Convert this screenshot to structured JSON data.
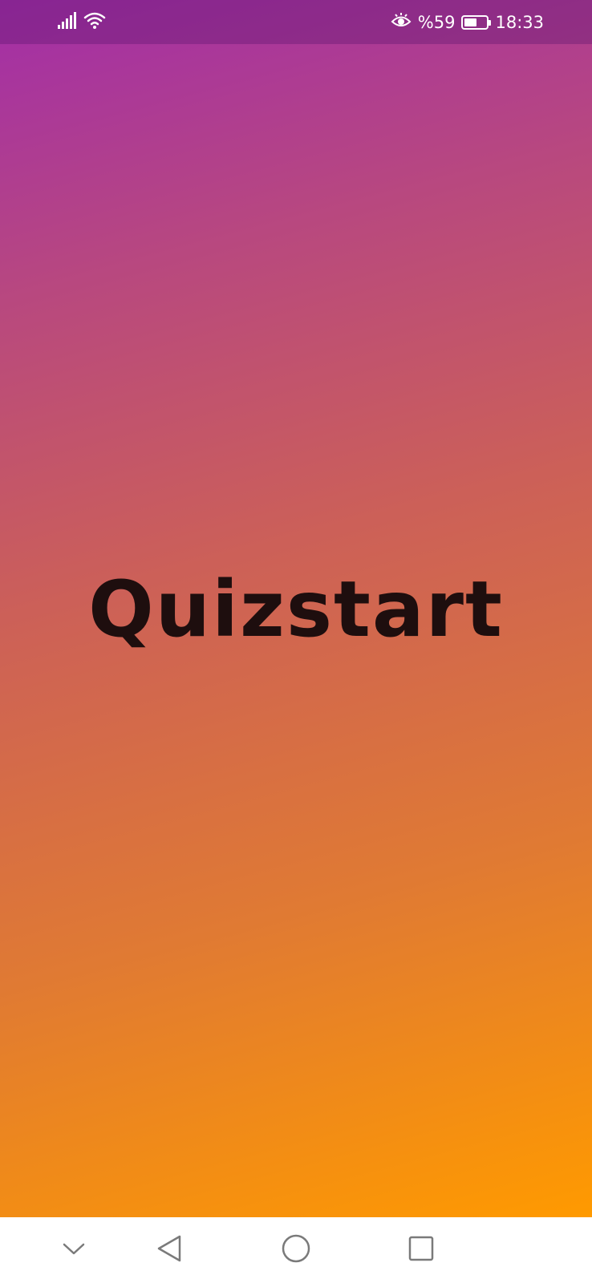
{
  "status_bar": {
    "battery_percent_label": "%59",
    "battery_level": 0.59,
    "time": "18:33",
    "icons": [
      "signal-icon",
      "wifi-icon",
      "eye-comfort-icon",
      "battery-icon"
    ]
  },
  "main": {
    "title": "Quizstart"
  },
  "navigation_bar": {
    "buttons": [
      "collapse",
      "back",
      "home",
      "recents"
    ]
  },
  "colors": {
    "gradient_start": "#a22ea8",
    "gradient_end": "#ff9a00",
    "title_color": "#1e0e0e",
    "nav_bar_background": "#ffffff",
    "nav_icon_color": "#7a7a7a"
  }
}
